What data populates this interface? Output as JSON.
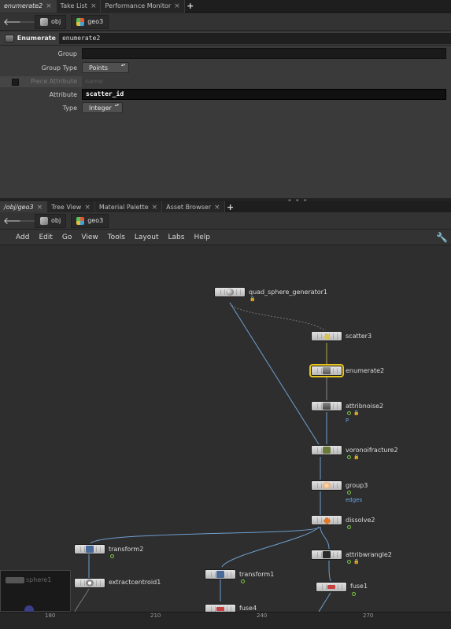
{
  "top_tabs": {
    "tabs": [
      {
        "label": "enumerate2",
        "active": true
      },
      {
        "label": "Take List",
        "active": false
      },
      {
        "label": "Performance Monitor",
        "active": false
      }
    ],
    "add": "+"
  },
  "top_path": {
    "crumb1": "obj",
    "crumb2": "geo3"
  },
  "parm_header": {
    "node_type": "Enumerate",
    "node_name": "enumerate2"
  },
  "parms": {
    "group_label": "Group",
    "group_value": "",
    "group_type_label": "Group Type",
    "group_type_value": "Points",
    "piece_attribute_label": "Piece Attribute",
    "piece_attribute_placeholder": "name",
    "attribute_label": "Attribute",
    "attribute_value": "scatter_id",
    "type_label": "Type",
    "type_value": "Integer"
  },
  "net_tabs": {
    "tabs": [
      {
        "label": "/obj/geo3",
        "active": true
      },
      {
        "label": "Tree View",
        "active": false
      },
      {
        "label": "Material Palette",
        "active": false
      },
      {
        "label": "Asset Browser",
        "active": false
      }
    ],
    "add": "+"
  },
  "net_path": {
    "crumb1": "obj",
    "crumb2": "geo3"
  },
  "menubar": {
    "items": [
      "Add",
      "Edit",
      "Go",
      "View",
      "Tools",
      "Layout",
      "Labs",
      "Help"
    ]
  },
  "nodes": {
    "quad_sphere_generator1": "quad_sphere_generator1",
    "scatter3": "scatter3",
    "enumerate2": "enumerate2",
    "attribnoise2": "attribnoise2",
    "attribnoise2_sub": "P",
    "voronoifracture2": "voronoifracture2",
    "group3": "group3",
    "group3_sub": "edges",
    "dissolve2": "dissolve2",
    "transform2": "transform2",
    "attribwrangle2": "attribwrangle2",
    "extractcentroid1": "extractcentroid1",
    "transform1": "transform1",
    "fuse1": "fuse1",
    "fuse4": "fuse4",
    "sphere1": "sphere1"
  },
  "ruler": {
    "ticks": [
      "180",
      "210",
      "240",
      "270"
    ]
  },
  "colors": {
    "selection": "#e6c520",
    "wire": "#6e9fd0",
    "flag": "#7ac943",
    "accent_blue": "#6aa8e6"
  }
}
